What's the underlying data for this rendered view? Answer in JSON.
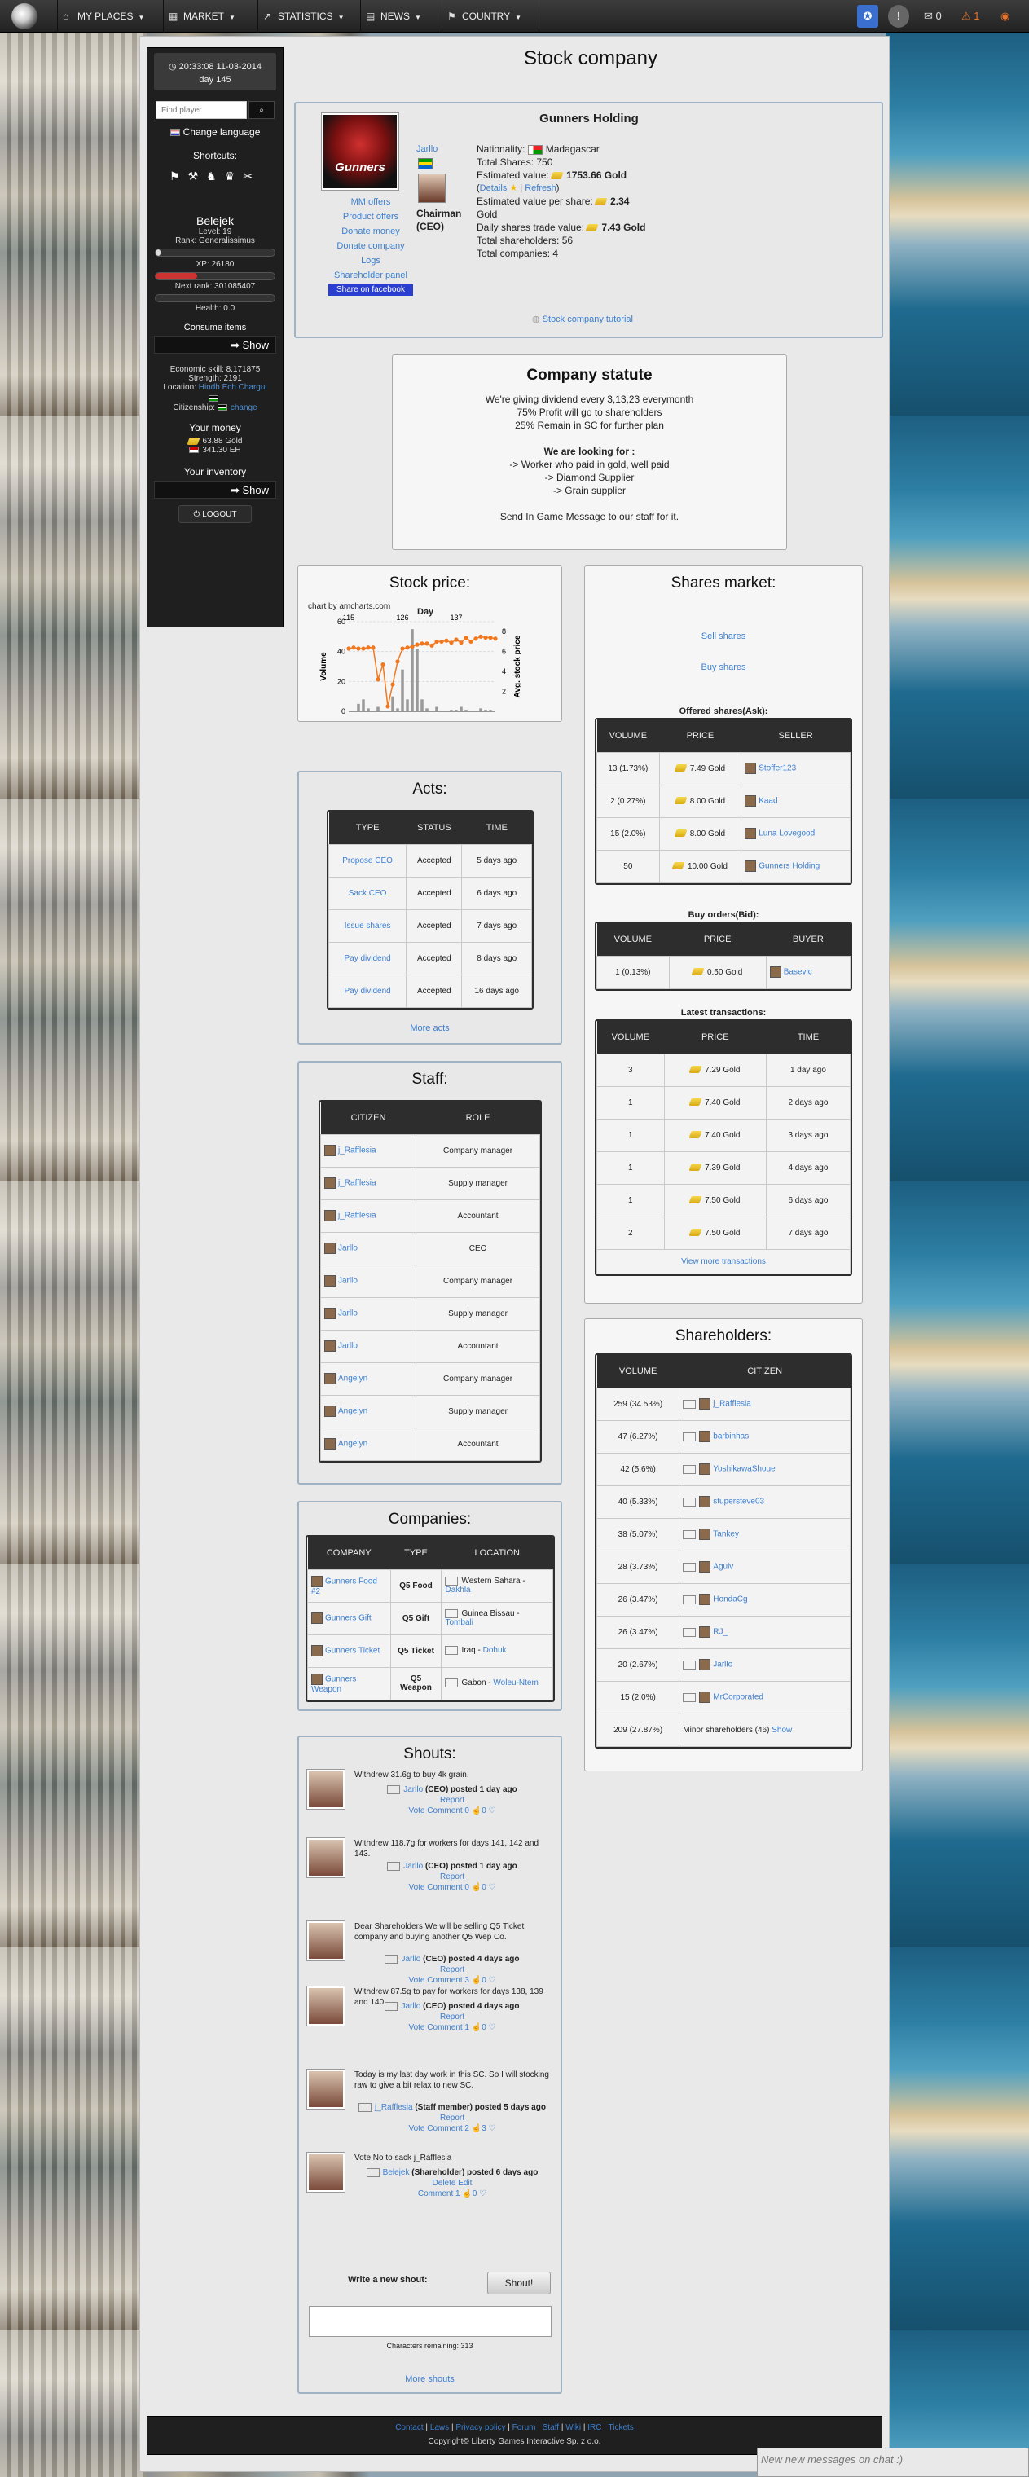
{
  "nav": {
    "items": [
      "MY PLACES",
      "MARKET",
      "STATISTICS",
      "NEWS",
      "COUNTRY"
    ],
    "mail_count": "0",
    "alert_count": "1"
  },
  "left": {
    "time": "20:33:08 11-03-2014",
    "day": "day 145",
    "search_placeholder": "Find player",
    "change_language": "Change language",
    "shortcuts": "Shortcuts:",
    "name": "Belejek",
    "level": "Level: 19",
    "rank": "Rank: Generalissimus",
    "xp": "XP: 26180",
    "next_rank": "Next rank: 301085407",
    "health": "Health: 0.0",
    "consume": "Consume items",
    "show": "Show",
    "eco": "Economic skill: 8.171875",
    "strength": "Strength: 2191",
    "location_label": "Location:",
    "location": "Hindh Ech Chargui",
    "citizenship_label": "Citizenship:",
    "change": "change",
    "money_title": "Your money",
    "gold": "63.88 Gold",
    "eh": "341.30 EH",
    "inventory": "Your inventory",
    "logout": "LOGOUT",
    "xp_fraction": 0.04
  },
  "page_title": "Stock company",
  "company": {
    "name": "Gunners Holding",
    "logo_text": "Gunners",
    "ceo": "Jarllo",
    "ceo_role": "Chairman (CEO)",
    "links": [
      "MM offers",
      "Product offers",
      "Donate money",
      "Donate company",
      "Logs",
      "Shareholder panel",
      "Share on facebook"
    ],
    "nationality_label": "Nationality:",
    "nationality": "Madagascar",
    "total_shares": "Total Shares: 750",
    "est_label": "Estimated value:",
    "est_value": "1753.66 Gold",
    "details": "Details",
    "refresh": "Refresh",
    "per_share_label": "Estimated value per share:",
    "per_share": "2.34",
    "gold_word": "Gold",
    "daily_label": "Daily shares trade value:",
    "daily": "7.43 Gold",
    "total_sh": "Total shareholders: 56",
    "total_comp": "Total companies: 4",
    "tutorial": "Stock company tutorial"
  },
  "statute": {
    "title": "Company statute",
    "lines": [
      "We're giving dividend every 3,13,23 everymonth",
      "75% Profit will go to shareholders",
      "25% Remain in SC for further plan",
      "",
      "We are looking for :",
      "-> Worker who paid in gold, well paid",
      "-> Diamond Supplier",
      "-> Grain supplier",
      "",
      "Send In Game Message to our staff for it."
    ]
  },
  "stock_price": {
    "title": "Stock price:",
    "credit": "chart by amcharts.com",
    "day_label": "Day",
    "x_ticks": [
      "115",
      "126",
      "137"
    ],
    "ylabel_left": "Volume",
    "ylabel_right": "Avg. stock price",
    "yleft": [
      "60",
      "40",
      "20",
      "0"
    ],
    "yright": [
      "8",
      "6",
      "4",
      "2"
    ]
  },
  "chart_data": {
    "type": "line",
    "title": "Stock price:",
    "xlabel": "Day",
    "ylabel": "Volume",
    "y2label": "Avg. stock price",
    "x": [
      115,
      116,
      117,
      118,
      119,
      120,
      121,
      122,
      123,
      124,
      125,
      126,
      127,
      128,
      129,
      130,
      131,
      132,
      133,
      134,
      135,
      136,
      137,
      138,
      139,
      140,
      141,
      142,
      143,
      144,
      145
    ],
    "series": [
      {
        "name": "Volume",
        "type": "bar",
        "values": [
          0,
          0,
          5,
          8,
          2,
          0,
          3,
          0,
          0,
          10,
          2,
          28,
          8,
          55,
          42,
          8,
          2,
          0,
          3,
          0,
          0,
          1,
          1,
          3,
          1,
          0,
          0,
          2,
          1,
          1,
          0
        ]
      },
      {
        "name": "Avg. stock price",
        "type": "line",
        "values": [
          6.3,
          6.4,
          6.3,
          6.3,
          6.4,
          6.4,
          3.2,
          4.7,
          0.5,
          2.7,
          5.0,
          6.3,
          6.4,
          6.5,
          6.7,
          6.8,
          6.8,
          6.6,
          7.0,
          7.0,
          7.1,
          6.9,
          7.2,
          6.9,
          7.4,
          7.0,
          7.3,
          7.5,
          7.4,
          7.4,
          7.3
        ]
      }
    ],
    "ylim": [
      0,
      60
    ],
    "y2lim": [
      0,
      9
    ]
  },
  "acts": {
    "title": "Acts:",
    "headers": [
      "TYPE",
      "STATUS",
      "TIME"
    ],
    "rows": [
      [
        "Propose CEO",
        "Accepted",
        "5 days ago"
      ],
      [
        "Sack CEO",
        "Accepted",
        "6 days ago"
      ],
      [
        "Issue shares",
        "Accepted",
        "7 days ago"
      ],
      [
        "Pay dividend",
        "Accepted",
        "8 days ago"
      ],
      [
        "Pay dividend",
        "Accepted",
        "16 days ago"
      ]
    ],
    "more": "More acts"
  },
  "staff": {
    "title": "Staff:",
    "headers": [
      "CITIZEN",
      "ROLE"
    ],
    "rows": [
      [
        "j_Rafflesia",
        "Company manager"
      ],
      [
        "j_Rafflesia",
        "Supply manager"
      ],
      [
        "j_Rafflesia",
        "Accountant"
      ],
      [
        "Jarllo",
        "CEO"
      ],
      [
        "Jarllo",
        "Company manager"
      ],
      [
        "Jarllo",
        "Supply manager"
      ],
      [
        "Jarllo",
        "Accountant"
      ],
      [
        "Angelyn",
        "Company manager"
      ],
      [
        "Angelyn",
        "Supply manager"
      ],
      [
        "Angelyn",
        "Accountant"
      ]
    ]
  },
  "companies": {
    "title": "Companies:",
    "headers": [
      "COMPANY",
      "TYPE",
      "LOCATION"
    ],
    "rows": [
      [
        "Gunners Food #2",
        "Q5 Food",
        "Western Sahara -",
        "Dakhla"
      ],
      [
        "Gunners Gift",
        "Q5 Gift",
        "Guinea Bissau -",
        "Tombali"
      ],
      [
        "Gunners Ticket",
        "Q5 Ticket",
        "Iraq -",
        "Dohuk"
      ],
      [
        "Gunners Weapon",
        "Q5 Weapon",
        "Gabon -",
        "Woleu-Ntem"
      ]
    ]
  },
  "shouts": {
    "title": "Shouts:",
    "items": [
      {
        "text": "Withdrew 31.6g to buy 4k grain.",
        "author": "Jarllo",
        "role": "(CEO) posted 1 day ago"
      },
      {
        "text": "Withdrew 118.7g for workers for days 141, 142 and 143.",
        "author": "Jarllo",
        "role": "(CEO) posted 1 day ago"
      },
      {
        "text": "Dear Shareholders We will be selling Q5 Ticket company and buying another Q5 Wep Co.",
        "author": "Jarllo",
        "role": "(CEO) posted 4 days ago"
      },
      {
        "text": "Withdrew 87.5g to pay for workers for days 138, 139 and 140.",
        "author": "Jarllo",
        "role": "(CEO) posted 4 days ago"
      },
      {
        "text": "Today is my last day work in this SC. So I will stocking raw to give a bit relax to new SC.",
        "author": "j_Rafflesia",
        "role": "(Staff member) posted 5 days ago"
      },
      {
        "text": "Vote No to sack j_Rafflesia",
        "author": "Belejek",
        "role": "(Shareholder) posted 6 days ago"
      }
    ],
    "report": "Report",
    "vote": "Vote",
    "comment": "Comment",
    "delete": "Delete",
    "edit": "Edit",
    "write": "Write a new shout:",
    "shout_btn": "Shout!",
    "chars": "Characters remaining: 313",
    "more": "More shouts",
    "comment_counts": [
      "0",
      "0",
      "3",
      "1",
      "2",
      "1"
    ],
    "vote_counts": [
      "0",
      "0",
      "0",
      "0",
      "3",
      "0"
    ]
  },
  "market": {
    "title": "Shares market:",
    "sell": "Sell shares",
    "buy": "Buy shares",
    "offered_title": "Offered shares(Ask):",
    "offered_headers": [
      "VOLUME",
      "PRICE",
      "SELLER"
    ],
    "offered": [
      [
        "13 (1.73%)",
        "7.49 Gold",
        "Stoffer123"
      ],
      [
        "2 (0.27%)",
        "8.00 Gold",
        "Kaad"
      ],
      [
        "15 (2.0%)",
        "8.00 Gold",
        "Luna Lovegood"
      ],
      [
        "50",
        "10.00 Gold",
        "Gunners Holding"
      ]
    ],
    "bids_title": "Buy orders(Bid):",
    "bids_headers": [
      "VOLUME",
      "PRICE",
      "BUYER"
    ],
    "bids": [
      [
        "1 (0.13%)",
        "0.50 Gold",
        "Basevic"
      ]
    ],
    "latest_title": "Latest transactions:",
    "latest_headers": [
      "VOLUME",
      "PRICE",
      "TIME"
    ],
    "latest": [
      [
        "3",
        "7.29 Gold",
        "1 day ago"
      ],
      [
        "1",
        "7.40 Gold",
        "2 days ago"
      ],
      [
        "1",
        "7.40 Gold",
        "3 days ago"
      ],
      [
        "1",
        "7.39 Gold",
        "4 days ago"
      ],
      [
        "1",
        "7.50 Gold",
        "6 days ago"
      ],
      [
        "2",
        "7.50 Gold",
        "7 days ago"
      ]
    ],
    "view_more": "View more transactions"
  },
  "shareholders": {
    "title": "Shareholders:",
    "headers": [
      "VOLUME",
      "CITIZEN"
    ],
    "rows": [
      [
        "259 (34.53%)",
        "j_Rafflesia"
      ],
      [
        "47 (6.27%)",
        "barbinhas"
      ],
      [
        "42 (5.6%)",
        "YoshikawaShoue"
      ],
      [
        "40 (5.33%)",
        "stupersteve03"
      ],
      [
        "38 (5.07%)",
        "Tankey"
      ],
      [
        "28 (3.73%)",
        "Aguiv"
      ],
      [
        "26 (3.47%)",
        "HondaCg"
      ],
      [
        "26 (3.47%)",
        "RJ_"
      ],
      [
        "20 (2.67%)",
        "Jarllo"
      ],
      [
        "15 (2.0%)",
        "MrCorporated"
      ],
      [
        "209 (27.87%)",
        "Minor shareholders (46)"
      ]
    ],
    "show": "Show"
  },
  "footer": {
    "links": [
      "Contact",
      "Laws",
      "Privacy policy",
      "Forum",
      "Staff",
      "Wiki",
      "IRC",
      "Tickets"
    ],
    "copyright": "Copyright© Liberty Games Interactive Sp. z o.o."
  },
  "chat": "New new messages on chat :)"
}
